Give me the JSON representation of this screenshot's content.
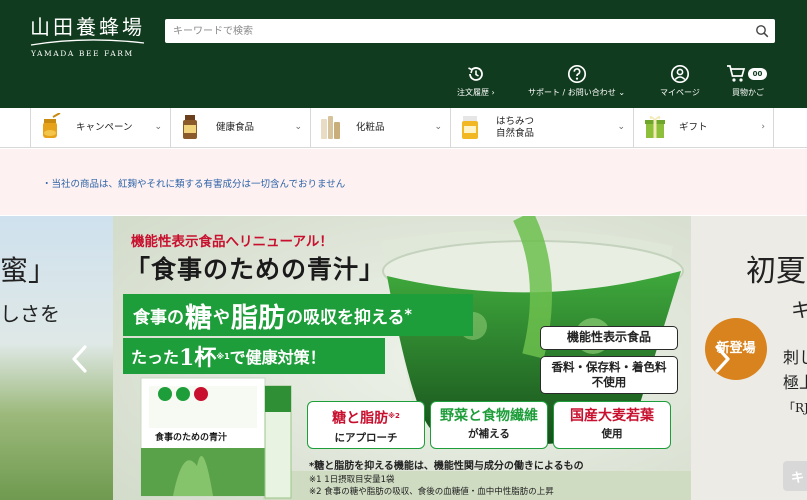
{
  "header": {
    "logo_jp": "山田養蜂場",
    "logo_en": "YAMADA BEE FARM",
    "search_placeholder": "キーワードで検索",
    "nav": [
      {
        "label": "注文履歴 ›",
        "icon": "history-icon"
      },
      {
        "label": "サポート / お問い合わせ ⌄",
        "icon": "help-icon"
      },
      {
        "label": "マイページ",
        "icon": "user-icon"
      },
      {
        "label": "買物かご",
        "icon": "cart-icon",
        "badge": "00"
      }
    ]
  },
  "categories": [
    {
      "label": "キャンペーン",
      "chevron": "⌄",
      "icon": "honey-jar-icon"
    },
    {
      "label": "健康食品",
      "chevron": "⌄",
      "icon": "supplement-bottle-icon"
    },
    {
      "label": "化粧品",
      "chevron": "⌄",
      "icon": "cosmetics-icon"
    },
    {
      "label": "はちみつ\n自然食品",
      "chevron": "⌄",
      "icon": "honey-icon"
    },
    {
      "label": "ギフト",
      "chevron": "›",
      "icon": "gift-icon"
    }
  ],
  "notice": {
    "text": "・当社の商品は、紅麹やそれに類する有害成分は一切含んでおりません"
  },
  "carousel": {
    "left_slide": {
      "line1": "蜜」",
      "line2": "しさを"
    },
    "main_slide": {
      "headline": "機能性表示食品へリニューアル！",
      "title": "「食事のための青汁」",
      "band1_pre": "食事の",
      "band1_big1": "糖",
      "band1_mid": "や",
      "band1_big2": "脂肪",
      "band1_post": "の吸収を抑える",
      "band1_mark": "*",
      "band2_pre": "たった",
      "band2_big": "1杯",
      "band2_sup": "※1",
      "band2_post": "で健康対策！",
      "badge1": "機能性表示食品",
      "badge2": "香料・保存料・着色料\n不使用",
      "features": [
        {
          "top": "糖と脂肪",
          "top_sup": "※2",
          "bottom": "にアプローチ"
        },
        {
          "top": "野菜と食物繊維",
          "bottom": "が補える"
        },
        {
          "top": "国産大麦若葉",
          "bottom": "使用"
        }
      ],
      "footnote1": "*糖と脂肪を抑える機能は、機能性関与成分の働きによるもの",
      "footnote2": "※1 1日摂取目安量1袋",
      "footnote3": "※2 食事の糖や脂肪の吸収、食後の血糖値・血中中性脂肪の上昇",
      "package_label": "食事のための青汁"
    },
    "right_slide": {
      "title": "初夏",
      "sub": "キ",
      "badge": "新登場",
      "line1": "刺し",
      "line2": "極上",
      "line3": "「RJ」マ",
      "button": "キ"
    },
    "prev_arrow": "‹",
    "next_arrow": "›"
  },
  "colors": {
    "header_bg": "#103b1e",
    "notice_bg": "#fdf2f1",
    "notice_text": "#2d62a8",
    "accent_green": "#1e9e3a",
    "accent_red": "#c8102e",
    "badge_orange": "#d9831e"
  }
}
